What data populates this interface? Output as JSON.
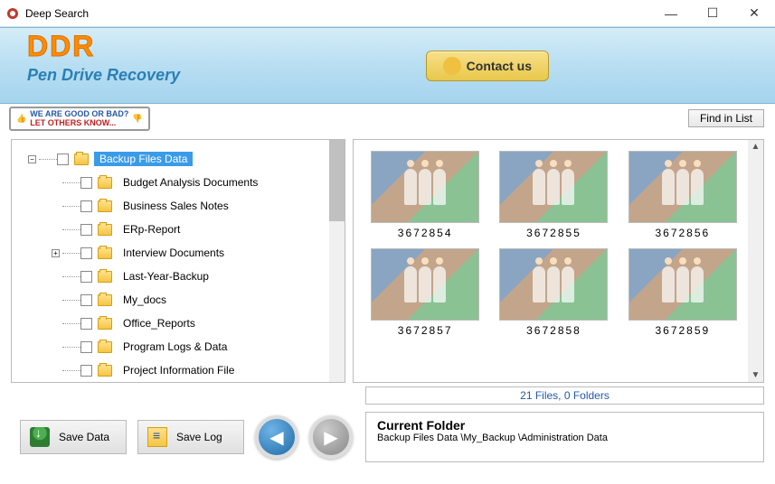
{
  "window": {
    "title": "Deep Search",
    "minimize": "—",
    "maximize": "☐",
    "close": "✕"
  },
  "header": {
    "logo": "DDR",
    "subtitle": "Pen Drive Recovery",
    "contact_label": "Contact us"
  },
  "toolbar": {
    "feedback_line1": "WE ARE GOOD OR BAD?",
    "feedback_line2": "LET OTHERS KNOW...",
    "find_in_list": "Find in List"
  },
  "tree": {
    "items": [
      {
        "label": "Backup Files Data",
        "selected": true,
        "expandable": true,
        "expanded": true,
        "level": 0
      },
      {
        "label": "Budget Analysis Documents",
        "level": 1
      },
      {
        "label": "Business Sales Notes",
        "level": 1
      },
      {
        "label": "ERp-Report",
        "level": 1
      },
      {
        "label": "Interview Documents",
        "expandable": true,
        "expanded": false,
        "level": 1
      },
      {
        "label": "Last-Year-Backup",
        "level": 1
      },
      {
        "label": "My_docs",
        "level": 1
      },
      {
        "label": "Office_Reports",
        "level": 1
      },
      {
        "label": "Program Logs & Data",
        "level": 1
      },
      {
        "label": "Project Information File",
        "level": 1
      }
    ]
  },
  "thumbnails": {
    "items": [
      {
        "name": "3672854"
      },
      {
        "name": "3672855"
      },
      {
        "name": "3672856"
      },
      {
        "name": "3672857"
      },
      {
        "name": "3672858"
      },
      {
        "name": "3672859"
      }
    ]
  },
  "status": {
    "text": "21 Files, 0 Folders"
  },
  "current_folder": {
    "title": "Current Folder",
    "path": "Backup Files Data \\My_Backup \\Administration Data"
  },
  "buttons": {
    "save_data": "Save Data",
    "save_log": "Save Log",
    "prev": "◀",
    "next": "▶"
  }
}
